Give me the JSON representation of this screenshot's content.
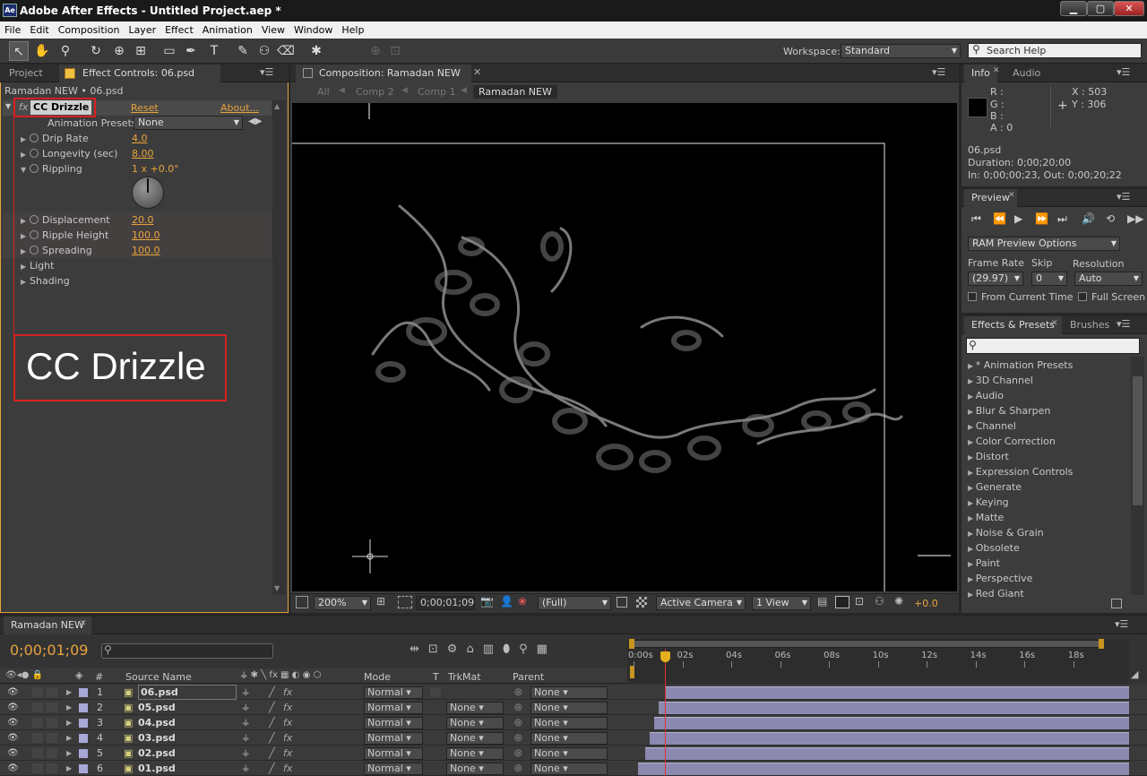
{
  "app": {
    "title": "Adobe After Effects - Untitled Project.aep *",
    "icon": "Ae"
  },
  "window_buttons": {
    "minimize": "▁",
    "maximize": "▢",
    "close": "✕"
  },
  "menu": [
    "File",
    "Edit",
    "Composition",
    "Layer",
    "Effect",
    "Animation",
    "View",
    "Window",
    "Help"
  ],
  "toolbar": {
    "workspace_label": "Workspace:",
    "workspace_value": "Standard",
    "search_placeholder": "Search Help"
  },
  "left_panel": {
    "tabs": [
      "Project",
      "Effect Controls: 06.psd"
    ],
    "breadcrumb": "Ramadan NEW • 06.psd",
    "effect": {
      "name": "CC Drizzle",
      "reset": "Reset",
      "about": "About..."
    },
    "presets_label": "Animation Presets:",
    "presets_value": "None",
    "params": [
      {
        "label": "Drip Rate",
        "value": "4.0"
      },
      {
        "label": "Longevity (sec)",
        "value": "8.00"
      },
      {
        "label": "Rippling",
        "value": "1 x +0.0°"
      },
      {
        "label": "Displacement",
        "value": "20.0"
      },
      {
        "label": "Ripple Height",
        "value": "100.0"
      },
      {
        "label": "Spreading",
        "value": "100.0"
      },
      {
        "label": "Light",
        "value": ""
      },
      {
        "label": "Shading",
        "value": ""
      }
    ],
    "callout": "CC Drizzle"
  },
  "comp": {
    "tab": "Composition: Ramadan NEW",
    "crumbs": [
      "All",
      "Comp 2",
      "Comp 1",
      "Ramadan NEW"
    ],
    "footer": {
      "zoom": "200%",
      "timecode": "0;00;01;09",
      "resolution": "(Full)",
      "camera": "Active Camera",
      "views": "1 View",
      "offset": "+0.0"
    }
  },
  "info": {
    "tabs": [
      "Info",
      "Audio"
    ],
    "r": "R :",
    "g": "G :",
    "b": "B :",
    "a": "A : 0",
    "x": "X : 503",
    "y": "Y : 306",
    "file": "06.psd",
    "duration": "Duration: 0;00;20;00",
    "inout": "In: 0;00;00;23, Out: 0;00;20;22"
  },
  "preview": {
    "tab": "Preview",
    "ram": "RAM Preview Options",
    "frame_rate_label": "Frame Rate",
    "skip_label": "Skip",
    "resolution_label": "Resolution",
    "frame_rate": "(29.97)",
    "skip": "0",
    "resolution": "Auto",
    "from_current": "From Current Time",
    "full_screen": "Full Screen"
  },
  "effects_presets": {
    "tabs": [
      "Effects & Presets",
      "Brushes"
    ],
    "items": [
      "* Animation Presets",
      "3D Channel",
      "Audio",
      "Blur & Sharpen",
      "Channel",
      "Color Correction",
      "Distort",
      "Expression Controls",
      "Generate",
      "Keying",
      "Matte",
      "Noise & Grain",
      "Obsolete",
      "Paint",
      "Perspective",
      "Red Giant"
    ]
  },
  "timeline": {
    "tab": "Ramadan NEW",
    "timecode": "0;00;01;09",
    "headers": {
      "num": "#",
      "source": "Source Name",
      "mode": "Mode",
      "t": "T",
      "trkmat": "TrkMat",
      "parent": "Parent"
    },
    "ruler": [
      "0:00s",
      "02s",
      "04s",
      "06s",
      "08s",
      "10s",
      "12s",
      "14s",
      "16s",
      "18s"
    ],
    "layers": [
      {
        "num": "1",
        "name": "06.psd",
        "mode": "Normal",
        "trkmat": "",
        "parent": "None",
        "start": 0.0667
      },
      {
        "num": "2",
        "name": "05.psd",
        "mode": "Normal",
        "trkmat": "None",
        "parent": "None",
        "start": 0.055
      },
      {
        "num": "3",
        "name": "04.psd",
        "mode": "Normal",
        "trkmat": "None",
        "parent": "None",
        "start": 0.045
      },
      {
        "num": "4",
        "name": "03.psd",
        "mode": "Normal",
        "trkmat": "None",
        "parent": "None",
        "start": 0.035
      },
      {
        "num": "5",
        "name": "02.psd",
        "mode": "Normal",
        "trkmat": "None",
        "parent": "None",
        "start": 0.025
      },
      {
        "num": "6",
        "name": "01.psd",
        "mode": "Normal",
        "trkmat": "None",
        "parent": "None",
        "start": 0.01
      }
    ],
    "playhead_seconds": 1.3
  }
}
